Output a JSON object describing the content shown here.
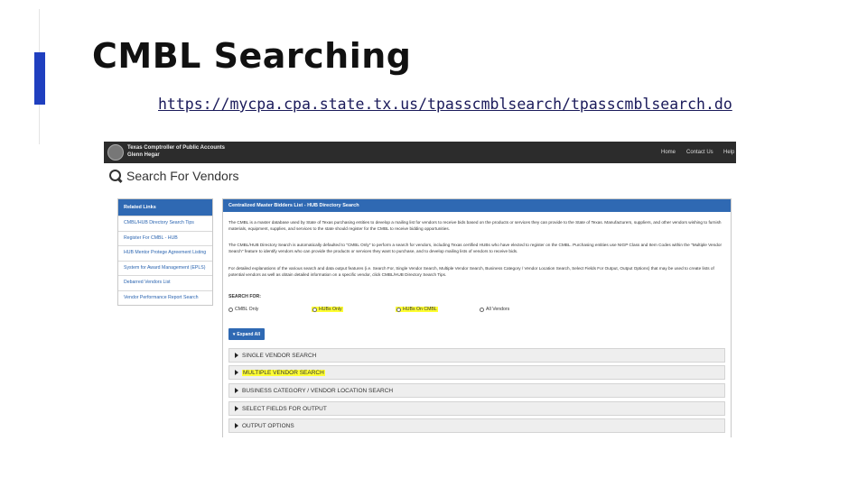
{
  "slide": {
    "title": "CMBL Searching",
    "url": "https://mycpa.cpa.state.tx.us/tpasscmblsearch/tpasscmblsearch.do"
  },
  "topbar": {
    "org_line1": "Texas Comptroller of Public Accounts",
    "org_line2": "Glenn Hegar",
    "nav": [
      "Home",
      "Contact Us",
      "Help"
    ]
  },
  "page": {
    "heading": "Search For Vendors"
  },
  "sidebar": {
    "title": "Related Links",
    "items": [
      "CMBL/HUB Directory Search Tips",
      "Register For CMBL - HUB",
      "HUB Mentor Protege Agreement Listing",
      "System for Award Management (EPLS)",
      "Debarred Vendors List",
      "Vendor Performance Report Search"
    ]
  },
  "panel": {
    "title": "Centralized Master Bidders List - HUB Directory Search",
    "para1": "The CMBL is a master database used by State of Texas purchasing entities to develop a mailing list for vendors to receive bids based on the products or services they can provide to the State of Texas. Manufacturers, suppliers, and other vendors wishing to furnish materials, equipment, supplies, and services to the state should register for the CMBL to receive bidding opportunities.",
    "para2": "The CMBL/HUB Directory Search is automatically defaulted to \"CMBL Only\" to perform a search for vendors, including Texas certified HUBs who have elected to register on the CMBL. Purchasing entities use NIGP Class and Item Codes within the \"Multiple Vendor Search\" feature to identify vendors who can provide the products or services they want to purchase, and to develop mailing lists of vendors to receive bids.",
    "para3": "For detailed explanations of the various search and data output features (i.e. Search For, Single Vendor Search, Multiple Vendor Search, Business Category / Vendor Location Search, Select Fields For Output, Output Options) that may be used to create lists of potential vendors as well as obtain detailed information on a specific vendor, click CMBL/HUB Directory Search Tips.",
    "search_for_label": "SEARCH FOR:",
    "radio_options": [
      "CMBL Only",
      "HUBs Only",
      "HUBs On CMBL",
      "All Vendors"
    ],
    "expand_label": "Expand All",
    "sections": [
      "SINGLE VENDOR SEARCH",
      "MULTIPLE VENDOR SEARCH",
      "BUSINESS CATEGORY / VENDOR LOCATION SEARCH",
      "SELECT FIELDS FOR OUTPUT",
      "OUTPUT OPTIONS"
    ]
  },
  "colors": {
    "accent": "#1f3fbf",
    "header_blue": "#2f69b3",
    "highlight": "#ffff33"
  }
}
